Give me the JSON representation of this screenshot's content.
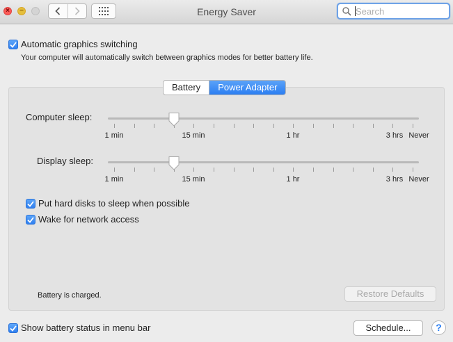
{
  "window": {
    "title": "Energy Saver"
  },
  "search": {
    "placeholder": "Search",
    "value": ""
  },
  "auto_graphics": {
    "label": "Automatic graphics switching",
    "checked": true,
    "description": "Your computer will automatically switch between graphics modes for better battery life."
  },
  "tabs": [
    {
      "label": "Battery",
      "selected": false
    },
    {
      "label": "Power Adapter",
      "selected": true
    }
  ],
  "computer_sleep": {
    "label": "Computer sleep:",
    "value": "15 min",
    "ticks": [
      "1 min",
      "15 min",
      "1 hr",
      "3 hrs",
      "Never"
    ]
  },
  "display_sleep": {
    "label": "Display sleep:",
    "value": "15 min",
    "ticks": [
      "1 min",
      "15 min",
      "1 hr",
      "3 hrs",
      "Never"
    ]
  },
  "options": [
    {
      "label": "Put hard disks to sleep when possible",
      "checked": true
    },
    {
      "label": "Wake for network access",
      "checked": true
    }
  ],
  "battery_status": "Battery is charged.",
  "restore_defaults": "Restore Defaults",
  "show_battery_status": {
    "label": "Show battery status in menu bar",
    "checked": true
  },
  "schedule_button": "Schedule...",
  "help_button": "?",
  "icons": [
    "close-icon",
    "minimize-icon",
    "zoom-icon",
    "chevron-left-icon",
    "chevron-right-icon",
    "grid-icon",
    "search-icon",
    "checkmark-icon",
    "slider-knob-icon"
  ],
  "colors": {
    "accent": "#2b7ef2",
    "close": "#fc5b57",
    "minimize": "#e5bf3c"
  }
}
